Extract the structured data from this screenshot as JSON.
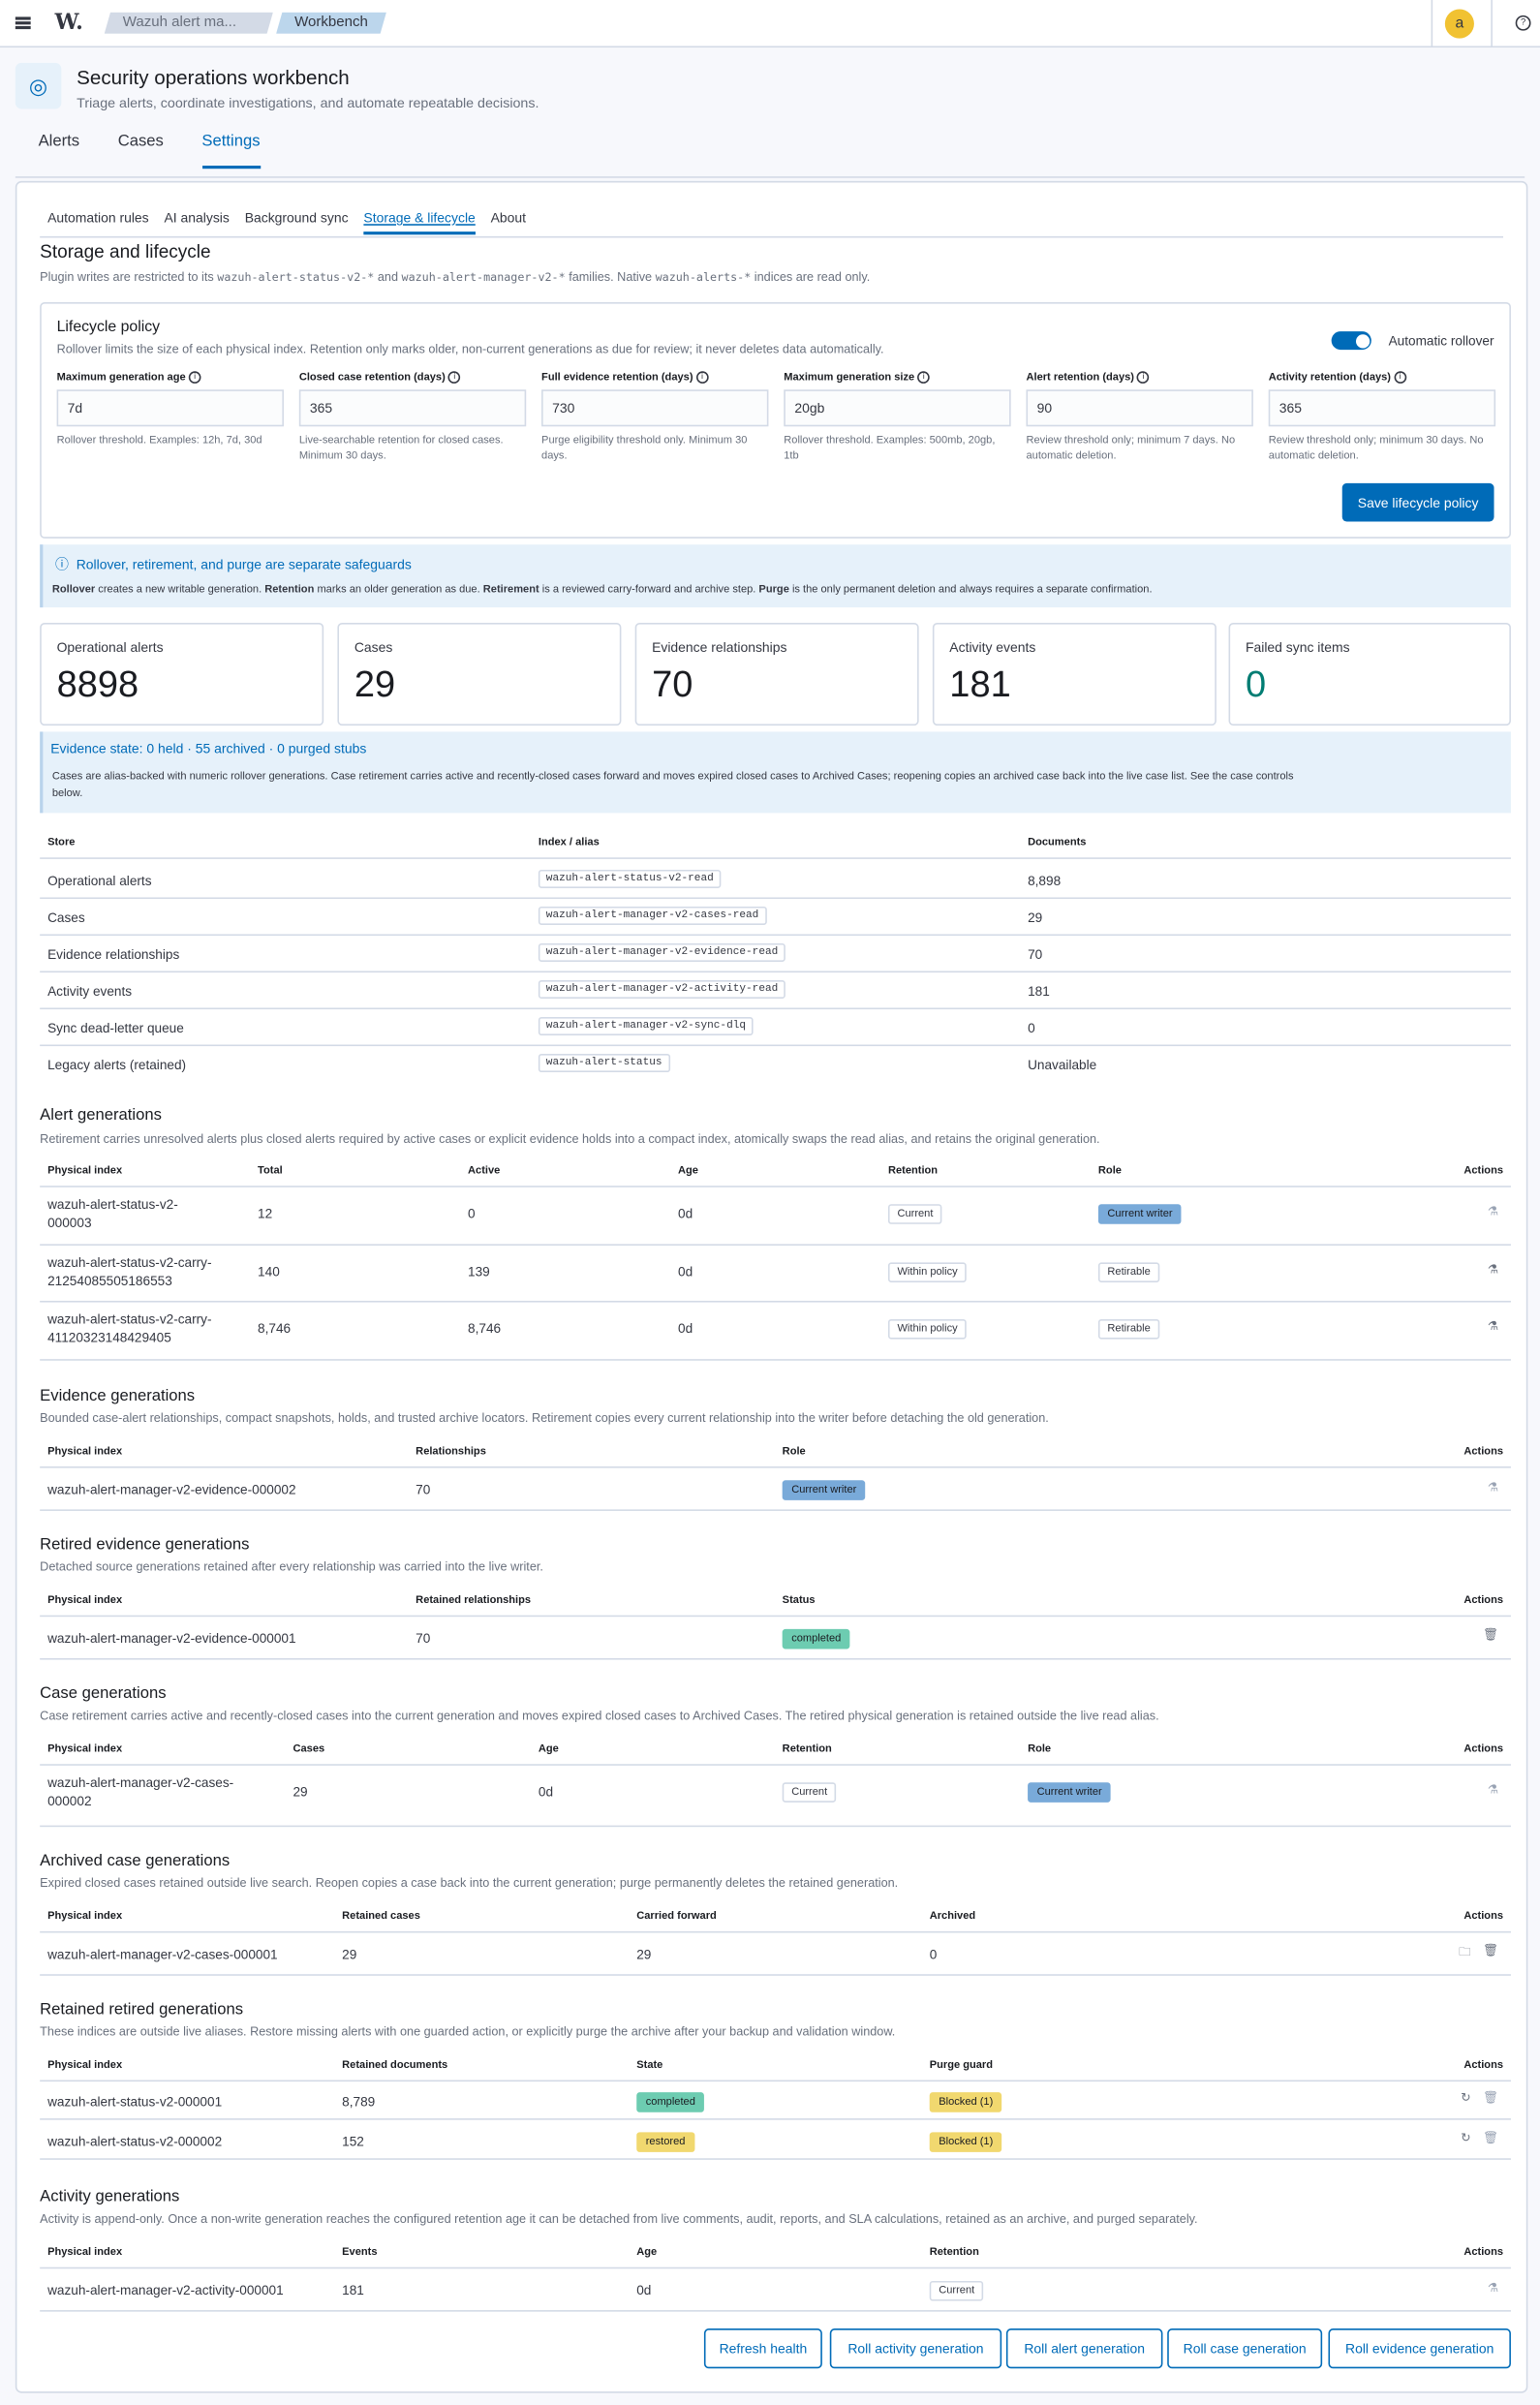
{
  "topbar": {
    "logo": "W.",
    "breadcrumbs": [
      "Wazuh alert ma...",
      "Workbench"
    ],
    "avatar": "a"
  },
  "header": {
    "title": "Security operations workbench",
    "subtitle": "Triage alerts, coordinate investigations, and automate repeatable decisions."
  },
  "main_tabs": [
    "Alerts",
    "Cases",
    "Settings"
  ],
  "sub_tabs": [
    "Automation rules",
    "AI analysis",
    "Background sync",
    "Storage & lifecycle",
    "About"
  ],
  "storage": {
    "title": "Storage and lifecycle",
    "desc_a": "Plugin writes are restricted to its ",
    "desc_code1": "wazuh-alert-status-v2-*",
    "desc_b": " and ",
    "desc_code2": "wazuh-alert-manager-v2-*",
    "desc_c": " families. Native ",
    "desc_code3": "wazuh-alerts-*",
    "desc_d": " indices are read only."
  },
  "lifecycle": {
    "title": "Lifecycle policy",
    "desc": "Rollover limits the size of each physical index. Retention only marks older, non-current generations as due for review; it never deletes data automatically.",
    "toggle_label": "Automatic rollover",
    "fields": [
      {
        "label": "Maximum generation age",
        "value": "7d",
        "help": "Rollover threshold. Examples: 12h, 7d, 30d"
      },
      {
        "label": "Closed case retention (days)",
        "value": "365",
        "help": "Live-searchable retention for closed cases. Minimum 30 days."
      },
      {
        "label": "Full evidence retention (days)",
        "value": "730",
        "help": "Purge eligibility threshold only. Minimum 30 days."
      },
      {
        "label": "Maximum generation size",
        "value": "20gb",
        "help": "Rollover threshold. Examples: 500mb, 20gb, 1tb"
      },
      {
        "label": "Alert retention (days)",
        "value": "90",
        "help": "Review threshold only; minimum 7 days. No automatic deletion."
      },
      {
        "label": "Activity retention (days)",
        "value": "365",
        "help": "Review threshold only; minimum 30 days. No automatic deletion."
      }
    ],
    "save_label": "Save lifecycle policy"
  },
  "safeguards": {
    "title": "Rollover, retirement, and purge are separate safeguards",
    "b1": "Rollover",
    "t1": " creates a new writable generation. ",
    "b2": "Retention",
    "t2": " marks an older generation as due. ",
    "b3": "Retirement",
    "t3": " is a reviewed carry-forward and archive step. ",
    "b4": "Purge",
    "t4": " is the only permanent deletion and always requires a separate confirmation."
  },
  "stats": [
    {
      "label": "Operational alerts",
      "value": "8898"
    },
    {
      "label": "Cases",
      "value": "29"
    },
    {
      "label": "Evidence relationships",
      "value": "70"
    },
    {
      "label": "Activity events",
      "value": "181"
    },
    {
      "label": "Failed sync items",
      "value": "0"
    }
  ],
  "evidence_state": {
    "title": "Evidence state: 0 held · 55 archived · 0 purged stubs",
    "text1": "Cases are alias-backed with numeric rollover generations. Case retirement carries active and recently-closed cases forward and moves expired closed cases to Archived Cases; reopening copies an archived case back into the live case list. See the case controls",
    "text2": "below."
  },
  "stores": {
    "headers": [
      "Store",
      "Index / alias",
      "Documents"
    ],
    "rows": [
      [
        "Operational alerts",
        "wazuh-alert-status-v2-read",
        "8,898"
      ],
      [
        "Cases",
        "wazuh-alert-manager-v2-cases-read",
        "29"
      ],
      [
        "Evidence relationships",
        "wazuh-alert-manager-v2-evidence-read",
        "70"
      ],
      [
        "Activity events",
        "wazuh-alert-manager-v2-activity-read",
        "181"
      ],
      [
        "Sync dead-letter queue",
        "wazuh-alert-manager-v2-sync-dlq",
        "0"
      ],
      [
        "Legacy alerts (retained)",
        "wazuh-alert-status",
        "Unavailable"
      ]
    ]
  },
  "alert_gen": {
    "title": "Alert generations",
    "desc": "Retirement carries unresolved alerts plus closed alerts required by active cases or explicit evidence holds into a compact index, atomically swaps the read alias, and retains the original generation.",
    "headers": [
      "Physical index",
      "Total",
      "Active",
      "Age",
      "Retention",
      "Role",
      "Actions"
    ],
    "rows": [
      {
        "index1": "wazuh-alert-status-v2-",
        "index2": "000003",
        "total": "12",
        "active": "0",
        "age": "0d",
        "retention": "Current",
        "role": "Current writer"
      },
      {
        "index1": "wazuh-alert-status-v2-carry-",
        "index2": "21254085505186553",
        "total": "140",
        "active": "139",
        "age": "0d",
        "retention": "Within policy",
        "role": "Retirable"
      },
      {
        "index1": "wazuh-alert-status-v2-carry-",
        "index2": "41120323148429405",
        "total": "8,746",
        "active": "8,746",
        "age": "0d",
        "retention": "Within policy",
        "role": "Retirable"
      }
    ]
  },
  "evidence_gen": {
    "title": "Evidence generations",
    "desc": "Bounded case-alert relationships, compact snapshots, holds, and trusted archive locators. Retirement copies every current relationship into the writer before detaching the old generation.",
    "headers": [
      "Physical index",
      "Relationships",
      "Role",
      "Actions"
    ],
    "rows": [
      {
        "index": "wazuh-alert-manager-v2-evidence-000002",
        "rel": "70",
        "role": "Current writer"
      }
    ]
  },
  "retired_evidence": {
    "title": "Retired evidence generations",
    "desc": "Detached source generations retained after every relationship was carried into the live writer.",
    "headers": [
      "Physical index",
      "Retained relationships",
      "Status",
      "Actions"
    ],
    "rows": [
      {
        "index": "wazuh-alert-manager-v2-evidence-000001",
        "rel": "70",
        "status": "completed"
      }
    ]
  },
  "case_gen": {
    "title": "Case generations",
    "desc": "Case retirement carries active and recently-closed cases into the current generation and moves expired closed cases to Archived Cases. The retired physical generation is retained outside the live read alias.",
    "headers": [
      "Physical index",
      "Cases",
      "Age",
      "Retention",
      "Role",
      "Actions"
    ],
    "rows": [
      {
        "index1": "wazuh-alert-manager-v2-cases-",
        "index2": "000002",
        "cases": "29",
        "age": "0d",
        "retention": "Current",
        "role": "Current writer"
      }
    ]
  },
  "archived_case": {
    "title": "Archived case generations",
    "desc": "Expired closed cases retained outside live search. Reopen copies a case back into the current generation; purge permanently deletes the retained generation.",
    "headers": [
      "Physical index",
      "Retained cases",
      "Carried forward",
      "Archived",
      "Actions"
    ],
    "rows": [
      {
        "index": "wazuh-alert-manager-v2-cases-000001",
        "retained": "29",
        "carried": "29",
        "archived": "0"
      }
    ]
  },
  "retained_retired": {
    "title": "Retained retired generations",
    "desc": "These indices are outside live aliases. Restore missing alerts with one guarded action, or explicitly purge the archive after your backup and validation window.",
    "headers": [
      "Physical index",
      "Retained documents",
      "State",
      "Purge guard",
      "Actions"
    ],
    "rows": [
      {
        "index": "wazuh-alert-status-v2-000001",
        "docs": "8,789",
        "state": "completed",
        "guard": "Blocked (1)"
      },
      {
        "index": "wazuh-alert-status-v2-000002",
        "docs": "152",
        "state": "restored",
        "guard": "Blocked (1)"
      }
    ]
  },
  "activity_gen": {
    "title": "Activity generations",
    "desc": "Activity is append-only. Once a non-write generation reaches the configured retention age it can be detached from live comments, audit, reports, and SLA calculations, retained as an archive, and purged separately.",
    "headers": [
      "Physical index",
      "Events",
      "Age",
      "Retention",
      "Actions"
    ],
    "rows": [
      {
        "index": "wazuh-alert-manager-v2-activity-000001",
        "events": "181",
        "age": "0d",
        "retention": "Current"
      }
    ]
  },
  "footer_buttons": [
    "Refresh health",
    "Roll activity generation",
    "Roll alert generation",
    "Roll case generation",
    "Roll evidence generation"
  ],
  "colors": {
    "accent": "#006bb8",
    "success": "#6dccb1",
    "warning": "#f1d86f",
    "writer": "#79aad9",
    "failed_zero": "#017d73"
  }
}
